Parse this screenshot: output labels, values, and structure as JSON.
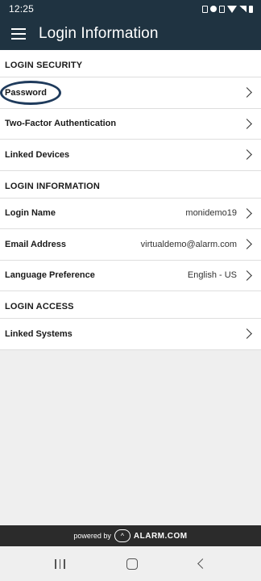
{
  "status_bar": {
    "time": "12:25"
  },
  "app_bar": {
    "title": "Login Information"
  },
  "sections": {
    "security": {
      "header": "LOGIN SECURITY",
      "password": "Password",
      "two_factor": "Two-Factor Authentication",
      "linked_devices": "Linked Devices"
    },
    "info": {
      "header": "LOGIN INFORMATION",
      "login_name_label": "Login Name",
      "login_name_value": "monidemo19",
      "email_label": "Email Address",
      "email_value": "virtualdemo@alarm.com",
      "language_label": "Language Preference",
      "language_value": "English - US"
    },
    "access": {
      "header": "LOGIN ACCESS",
      "linked_systems": "Linked Systems"
    }
  },
  "footer": {
    "powered_by": "powered by",
    "logo_glyph": "^",
    "brand": "ALARM.COM"
  }
}
